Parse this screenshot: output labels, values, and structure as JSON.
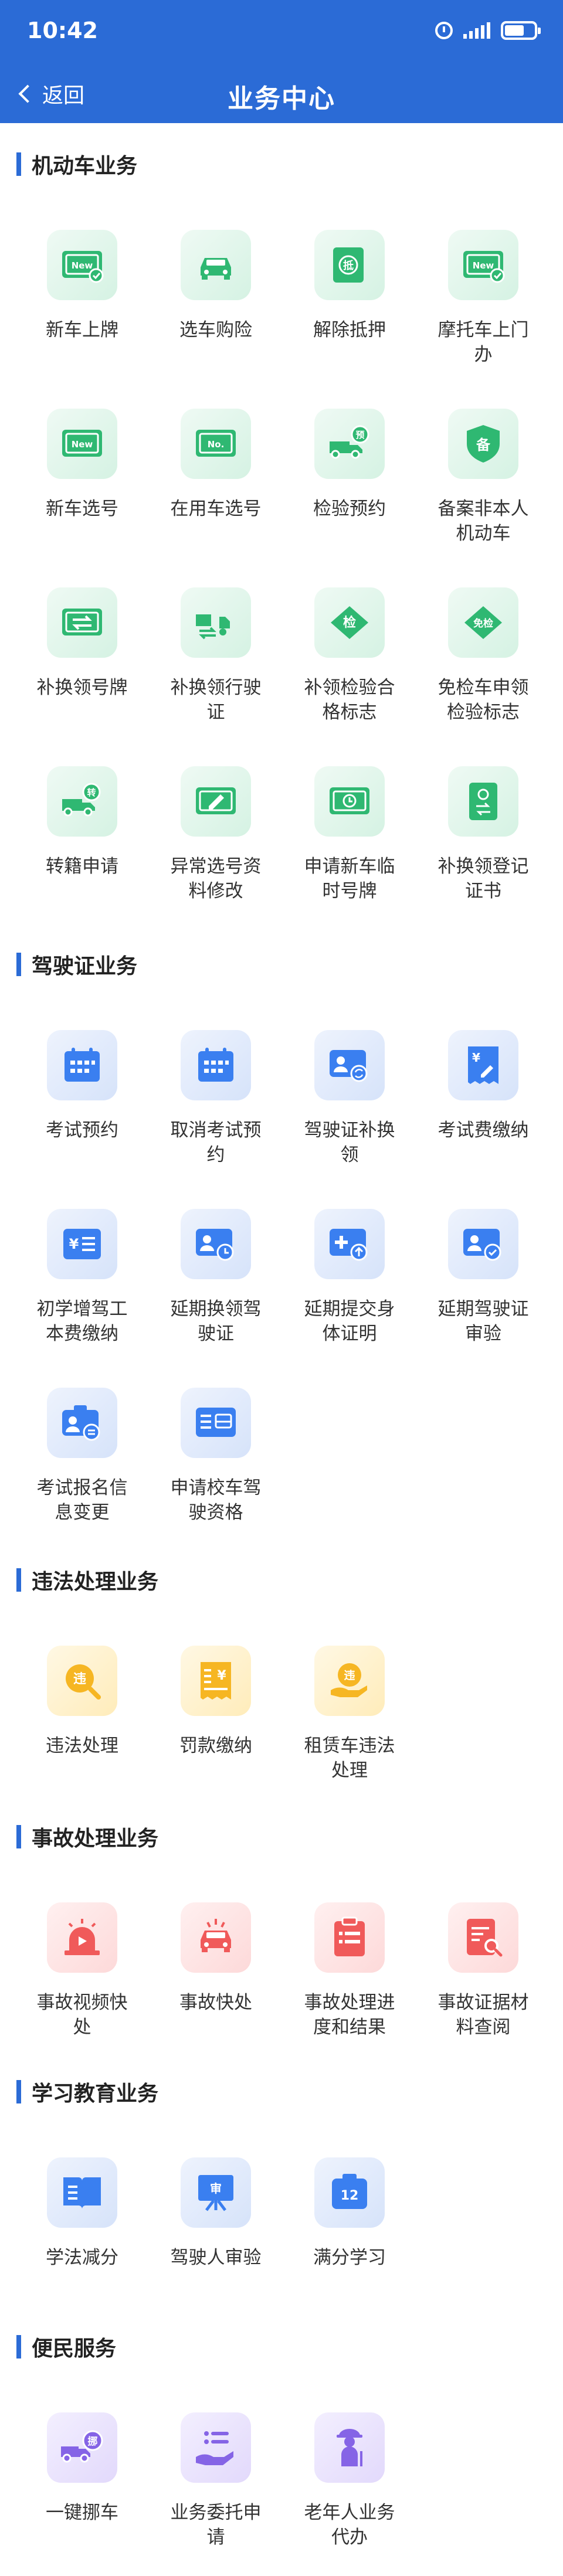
{
  "status_bar": {
    "time": "10:42"
  },
  "nav": {
    "back_label": "返回",
    "title": "业务中心"
  },
  "colors": {
    "header": "#2b6bd6",
    "green": "#2fb872",
    "blue": "#3a7ff0",
    "orange": "#f6b623",
    "red": "#f05a5a",
    "purple": "#8564e6"
  },
  "sections": [
    {
      "title": "机动车业务",
      "items": [
        {
          "label": "新车上牌",
          "icon": "new-plate-check-icon"
        },
        {
          "label": "选车购险",
          "icon": "car-icon"
        },
        {
          "label": "解除抵押",
          "icon": "mortgage-seal-icon"
        },
        {
          "label": "摩托车上门办",
          "icon": "new-plate-check-icon"
        },
        {
          "label": "新车选号",
          "icon": "new-plate-icon"
        },
        {
          "label": "在用车选号",
          "icon": "number-plate-icon"
        },
        {
          "label": "检验预约",
          "icon": "truck-reserve-icon"
        },
        {
          "label": "备案非本人机动车",
          "icon": "filing-shield-icon"
        },
        {
          "label": "补换领号牌",
          "icon": "plate-swap-icon"
        },
        {
          "label": "补换领行驶证",
          "icon": "vehicle-license-swap-icon"
        },
        {
          "label": "补领检验合格标志",
          "icon": "inspection-diamond-icon"
        },
        {
          "label": "免检车申领检验标志",
          "icon": "exempt-diamond-icon"
        },
        {
          "label": "转籍申请",
          "icon": "transfer-truck-icon"
        },
        {
          "label": "异常选号资料修改",
          "icon": "edit-card-icon"
        },
        {
          "label": "申请新车临时号牌",
          "icon": "temp-plate-clock-icon"
        },
        {
          "label": "补换领登记证书",
          "icon": "registration-certificate-icon"
        }
      ]
    },
    {
      "title": "驾驶证业务",
      "items": [
        {
          "label": "考试预约",
          "icon": "calendar-icon"
        },
        {
          "label": "取消考试预约",
          "icon": "calendar-cancel-icon"
        },
        {
          "label": "驾驶证补换领",
          "icon": "license-swap-icon"
        },
        {
          "label": "考试费缴纳",
          "icon": "fee-receipt-icon"
        },
        {
          "label": "初学增驾工本费缴纳",
          "icon": "yuan-list-icon"
        },
        {
          "label": "延期换领驾驶证",
          "icon": "license-clock-icon"
        },
        {
          "label": "延期提交身体证明",
          "icon": "medical-upload-icon"
        },
        {
          "label": "延期驾驶证审验",
          "icon": "license-check-icon"
        },
        {
          "label": "考试报名信息变更",
          "icon": "id-card-swap-icon"
        },
        {
          "label": "申请校车驾驶资格",
          "icon": "school-bus-card-icon"
        }
      ]
    },
    {
      "title": "违法处理业务",
      "items": [
        {
          "label": "违法处理",
          "icon": "violation-search-icon"
        },
        {
          "label": "罚款缴纳",
          "icon": "fine-receipt-icon"
        },
        {
          "label": "租赁车违法处理",
          "icon": "violation-hand-icon"
        }
      ]
    },
    {
      "title": "事故处理业务",
      "items": [
        {
          "label": "事故视频快处",
          "icon": "video-alarm-icon"
        },
        {
          "label": "事故快处",
          "icon": "car-crash-icon"
        },
        {
          "label": "事故处理进度和结果",
          "icon": "clipboard-icon"
        },
        {
          "label": "事故证据材料查阅",
          "icon": "document-search-icon"
        }
      ]
    },
    {
      "title": "学习教育业务",
      "items": [
        {
          "label": "学法减分",
          "icon": "book-icon"
        },
        {
          "label": "驾驶人审验",
          "icon": "review-board-icon"
        },
        {
          "label": "满分学习",
          "icon": "score-12-icon"
        }
      ]
    },
    {
      "title": "便民服务",
      "items": [
        {
          "label": "一键挪车",
          "icon": "move-truck-icon"
        },
        {
          "label": "业务委托申请",
          "icon": "delegate-hand-icon"
        },
        {
          "label": "老年人业务代办",
          "icon": "elderly-icon"
        }
      ]
    }
  ],
  "icon_text": {
    "new_tag": "New",
    "no_tag": "No.",
    "mortgage": "抵",
    "reserve": "预",
    "filing": "备",
    "inspection": "检",
    "exempt": "免检",
    "transfer": "转",
    "violation": "违",
    "fine": "¥",
    "yuan": "¥",
    "review": "审",
    "score": "12",
    "move": "挪"
  }
}
